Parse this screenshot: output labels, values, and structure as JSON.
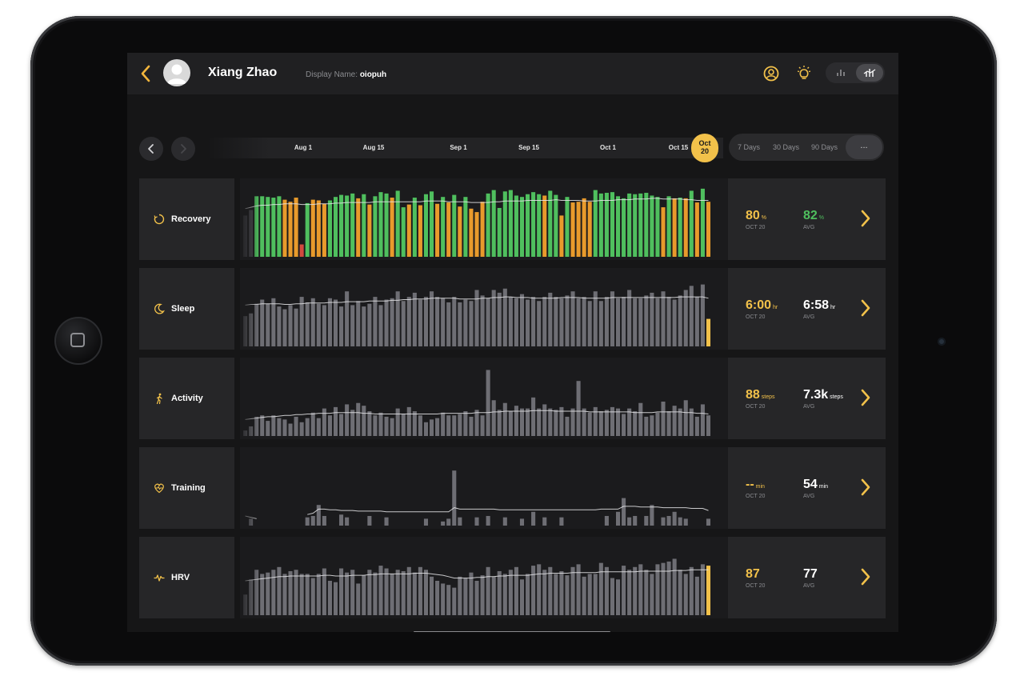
{
  "user": {
    "name": "Xiang Zhao",
    "display_label": "Display Name:",
    "display_value": "oiopuh"
  },
  "icons": {
    "back": "chevron-left-icon",
    "avatar": "avatar-icon",
    "profile": "user-circle-icon",
    "insight": "lightbulb-icon",
    "bar_view": "bar-chart-icon",
    "trend_view": "trend-chart-icon",
    "prev": "chevron-left-icon",
    "next": "chevron-right-icon",
    "open": "chevron-right-icon"
  },
  "timeline": {
    "labels": [
      "Aug 1",
      "Aug 15",
      "Sep 1",
      "Sep 15",
      "Oct 1",
      "Oct 15"
    ],
    "current_month": "Oct",
    "current_day": "20"
  },
  "ranges": {
    "options": [
      "7 Days",
      "30 Days",
      "90 Days"
    ],
    "more": "..."
  },
  "colors": {
    "accent": "#f2c14a",
    "green": "#4fbf5e",
    "orange": "#e89a2c",
    "red": "#d24a3f",
    "bar": "#6e6e74",
    "bg": "#161617"
  },
  "metrics": [
    {
      "key": "recovery",
      "label": "Recovery",
      "current": "80",
      "current_unit": "%",
      "current_caption": "OCT 20",
      "avg": "82",
      "avg_unit": "%",
      "avg_caption": "AVG"
    },
    {
      "key": "sleep",
      "label": "Sleep",
      "current": "6:00",
      "current_unit": "hr",
      "current_caption": "OCT 20",
      "avg": "6:58",
      "avg_unit": "hr",
      "avg_caption": "AVG"
    },
    {
      "key": "activity",
      "label": "Activity",
      "current": "88",
      "current_unit": "steps",
      "current_caption": "OCT 20",
      "avg": "7.3k",
      "avg_unit": "steps",
      "avg_caption": "AVG"
    },
    {
      "key": "training",
      "label": "Training",
      "current": "--",
      "current_unit": "min",
      "current_caption": "OCT 20",
      "avg": "54",
      "avg_unit": "min",
      "avg_caption": "AVG"
    },
    {
      "key": "hrv",
      "label": "HRV",
      "current": "87",
      "current_unit": "",
      "current_caption": "OCT 20",
      "avg": "77",
      "avg_unit": "",
      "avg_caption": "AVG"
    }
  ],
  "chart_data": [
    {
      "type": "bar",
      "name": "recovery",
      "ylim": [
        0,
        100
      ],
      "values": [
        60,
        68,
        88,
        88,
        87,
        86,
        88,
        83,
        80,
        86,
        18,
        78,
        83,
        82,
        77,
        82,
        87,
        90,
        89,
        92,
        85,
        91,
        76,
        88,
        94,
        92,
        86,
        96,
        72,
        76,
        86,
        75,
        91,
        95,
        77,
        87,
        79,
        90,
        73,
        87,
        70,
        65,
        80,
        92,
        97,
        71,
        95,
        97,
        89,
        87,
        91,
        94,
        91,
        89,
        96,
        90,
        60,
        87,
        79,
        80,
        85,
        80,
        97,
        92,
        93,
        94,
        88,
        85,
        92,
        91,
        92,
        93,
        89,
        87,
        72,
        88,
        85,
        86,
        85,
        96,
        79,
        99,
        80
      ],
      "colors": [
        "x",
        "x",
        "g",
        "g",
        "g",
        "g",
        "g",
        "o",
        "o",
        "o",
        "r",
        "g",
        "o",
        "o",
        "o",
        "g",
        "g",
        "g",
        "g",
        "g",
        "o",
        "g",
        "o",
        "g",
        "g",
        "g",
        "o",
        "g",
        "g",
        "o",
        "g",
        "o",
        "g",
        "g",
        "o",
        "g",
        "o",
        "g",
        "o",
        "g",
        "o",
        "o",
        "o",
        "g",
        "g",
        "g",
        "g",
        "g",
        "g",
        "g",
        "g",
        "g",
        "g",
        "o",
        "g",
        "g",
        "o",
        "g",
        "o",
        "o",
        "o",
        "o",
        "g",
        "g",
        "g",
        "g",
        "g",
        "g",
        "g",
        "g",
        "g",
        "g",
        "g",
        "g",
        "o",
        "g",
        "o",
        "g",
        "o",
        "g",
        "o",
        "g",
        "o"
      ],
      "avg_line": [
        70,
        72,
        74,
        75,
        75,
        76,
        76,
        77,
        77,
        77,
        76,
        76,
        76,
        77,
        77,
        77,
        78,
        78,
        79,
        79,
        79,
        79,
        79,
        80,
        80,
        80,
        80,
        80,
        80,
        80,
        80,
        80,
        81,
        81,
        81,
        81,
        80,
        80,
        80,
        80,
        79,
        79,
        79,
        79,
        80,
        80,
        81,
        81,
        81,
        81,
        82,
        82,
        82,
        82,
        82,
        83,
        82,
        82,
        82,
        82,
        81,
        81,
        81,
        82,
        82,
        82,
        83,
        83,
        83,
        84,
        84,
        84,
        85,
        85,
        84,
        84,
        84,
        84,
        83,
        83,
        82,
        82,
        82
      ]
    },
    {
      "type": "bar",
      "name": "sleep",
      "ylim": [
        0,
        100
      ],
      "highlight_last": true,
      "values": [
        44,
        48,
        62,
        68,
        62,
        70,
        58,
        54,
        60,
        55,
        72,
        64,
        70,
        62,
        60,
        70,
        68,
        58,
        80,
        60,
        66,
        58,
        62,
        72,
        60,
        68,
        70,
        80,
        66,
        72,
        78,
        68,
        72,
        80,
        72,
        70,
        64,
        72,
        64,
        68,
        66,
        82,
        74,
        70,
        82,
        78,
        84,
        72,
        70,
        76,
        68,
        72,
        66,
        72,
        78,
        72,
        70,
        74,
        80,
        70,
        72,
        66,
        80,
        66,
        72,
        80,
        70,
        72,
        82,
        70,
        70,
        74,
        78,
        70,
        80,
        72,
        68,
        74,
        82,
        88,
        72,
        90,
        40
      ],
      "avg_line": [
        60,
        61,
        61,
        62,
        62,
        62,
        62,
        61,
        61,
        62,
        62,
        63,
        63,
        63,
        63,
        64,
        64,
        64,
        65,
        65,
        65,
        65,
        66,
        66,
        66,
        66,
        67,
        67,
        68,
        68,
        69,
        69,
        69,
        70,
        70,
        70,
        70,
        70,
        69,
        69,
        69,
        69,
        70,
        70,
        71,
        71,
        72,
        72,
        71,
        71,
        71,
        70,
        70,
        70,
        70,
        70,
        71,
        71,
        71,
        71,
        70,
        70,
        70,
        70,
        70,
        71,
        71,
        71,
        71,
        71,
        71,
        71,
        71,
        71,
        71,
        71,
        71,
        72,
        72,
        72,
        72,
        72,
        70
      ]
    },
    {
      "type": "bar",
      "name": "activity",
      "ylim": [
        0,
        100
      ],
      "values": [
        8,
        14,
        28,
        30,
        22,
        30,
        26,
        24,
        18,
        28,
        20,
        26,
        34,
        26,
        40,
        30,
        42,
        32,
        46,
        38,
        48,
        44,
        36,
        30,
        34,
        28,
        26,
        40,
        32,
        42,
        36,
        30,
        20,
        24,
        26,
        34,
        30,
        30,
        32,
        36,
        28,
        38,
        30,
        96,
        52,
        38,
        48,
        36,
        44,
        40,
        40,
        56,
        40,
        46,
        40,
        38,
        42,
        28,
        40,
        80,
        40,
        34,
        42,
        36,
        38,
        42,
        40,
        32,
        40,
        36,
        48,
        28,
        30,
        34,
        50,
        36,
        44,
        40,
        52,
        40,
        28,
        46,
        30
      ],
      "avg_line": [
        24,
        25,
        26,
        27,
        28,
        28,
        29,
        30,
        30,
        31,
        31,
        32,
        32,
        33,
        33,
        33,
        34,
        34,
        34,
        34,
        34,
        33,
        33,
        32,
        32,
        32,
        32,
        32,
        32,
        32,
        32,
        32,
        32,
        32,
        32,
        33,
        33,
        33,
        33,
        33,
        33,
        34,
        34,
        34,
        35,
        35,
        36,
        36,
        36,
        36,
        36,
        37,
        37,
        37,
        37,
        36,
        36,
        36,
        36,
        36,
        36,
        35,
        35,
        35,
        35,
        35,
        35,
        35,
        35,
        34,
        34,
        34,
        34,
        35,
        35,
        35,
        35,
        35,
        34,
        34,
        33,
        33,
        32
      ]
    },
    {
      "type": "bar",
      "name": "training",
      "ylim": [
        0,
        100
      ],
      "values": [
        0,
        10,
        0,
        0,
        0,
        0,
        0,
        0,
        0,
        0,
        0,
        12,
        14,
        30,
        14,
        0,
        0,
        16,
        12,
        0,
        0,
        0,
        14,
        0,
        0,
        12,
        0,
        0,
        0,
        0,
        0,
        0,
        10,
        0,
        0,
        6,
        10,
        80,
        12,
        0,
        0,
        12,
        0,
        14,
        0,
        0,
        12,
        0,
        0,
        10,
        0,
        20,
        0,
        12,
        0,
        0,
        12,
        0,
        0,
        0,
        0,
        0,
        0,
        0,
        14,
        0,
        20,
        40,
        12,
        14,
        0,
        14,
        30,
        0,
        12,
        14,
        20,
        12,
        10,
        0,
        0,
        0,
        10
      ],
      "avg_line": [
        14,
        12,
        10,
        null,
        null,
        null,
        null,
        null,
        null,
        null,
        null,
        16,
        18,
        24,
        24,
        23,
        23,
        22,
        22,
        22,
        21,
        21,
        21,
        21,
        21,
        20,
        20,
        20,
        20,
        20,
        20,
        20,
        20,
        20,
        20,
        20,
        20,
        26,
        24,
        24,
        24,
        24,
        24,
        24,
        24,
        23,
        23,
        23,
        23,
        23,
        23,
        23,
        23,
        23,
        23,
        23,
        23,
        23,
        23,
        23,
        23,
        23,
        23,
        24,
        24,
        24,
        24,
        28,
        28,
        28,
        27,
        27,
        27,
        27,
        26,
        26,
        26,
        26,
        26,
        25,
        25,
        25,
        22
      ]
    },
    {
      "type": "bar",
      "name": "hrv",
      "ylim": [
        0,
        100
      ],
      "highlight_last": true,
      "values": [
        30,
        52,
        66,
        60,
        62,
        66,
        70,
        60,
        64,
        66,
        60,
        60,
        54,
        60,
        68,
        50,
        48,
        68,
        62,
        66,
        46,
        58,
        66,
        62,
        72,
        68,
        60,
        66,
        64,
        70,
        62,
        70,
        66,
        56,
        50,
        46,
        44,
        40,
        56,
        54,
        62,
        50,
        58,
        70,
        56,
        64,
        60,
        66,
        70,
        52,
        60,
        72,
        74,
        66,
        70,
        60,
        64,
        58,
        70,
        74,
        56,
        60,
        60,
        76,
        70,
        54,
        52,
        72,
        66,
        70,
        74,
        66,
        60,
        74,
        76,
        78,
        82,
        66,
        60,
        70,
        56,
        74,
        72
      ],
      "avg_line": [
        50,
        51,
        52,
        53,
        54,
        55,
        56,
        56,
        57,
        57,
        57,
        57,
        57,
        57,
        58,
        58,
        57,
        57,
        57,
        58,
        58,
        58,
        59,
        59,
        60,
        60,
        60,
        60,
        60,
        60,
        61,
        61,
        61,
        60,
        59,
        58,
        56,
        54,
        54,
        54,
        54,
        55,
        55,
        56,
        56,
        57,
        57,
        58,
        58,
        58,
        58,
        59,
        60,
        60,
        61,
        61,
        61,
        61,
        62,
        62,
        62,
        62,
        62,
        63,
        63,
        63,
        63,
        63,
        63,
        63,
        64,
        64,
        64,
        64,
        64,
        64,
        65,
        65,
        65,
        66,
        66,
        66,
        66
      ]
    }
  ]
}
